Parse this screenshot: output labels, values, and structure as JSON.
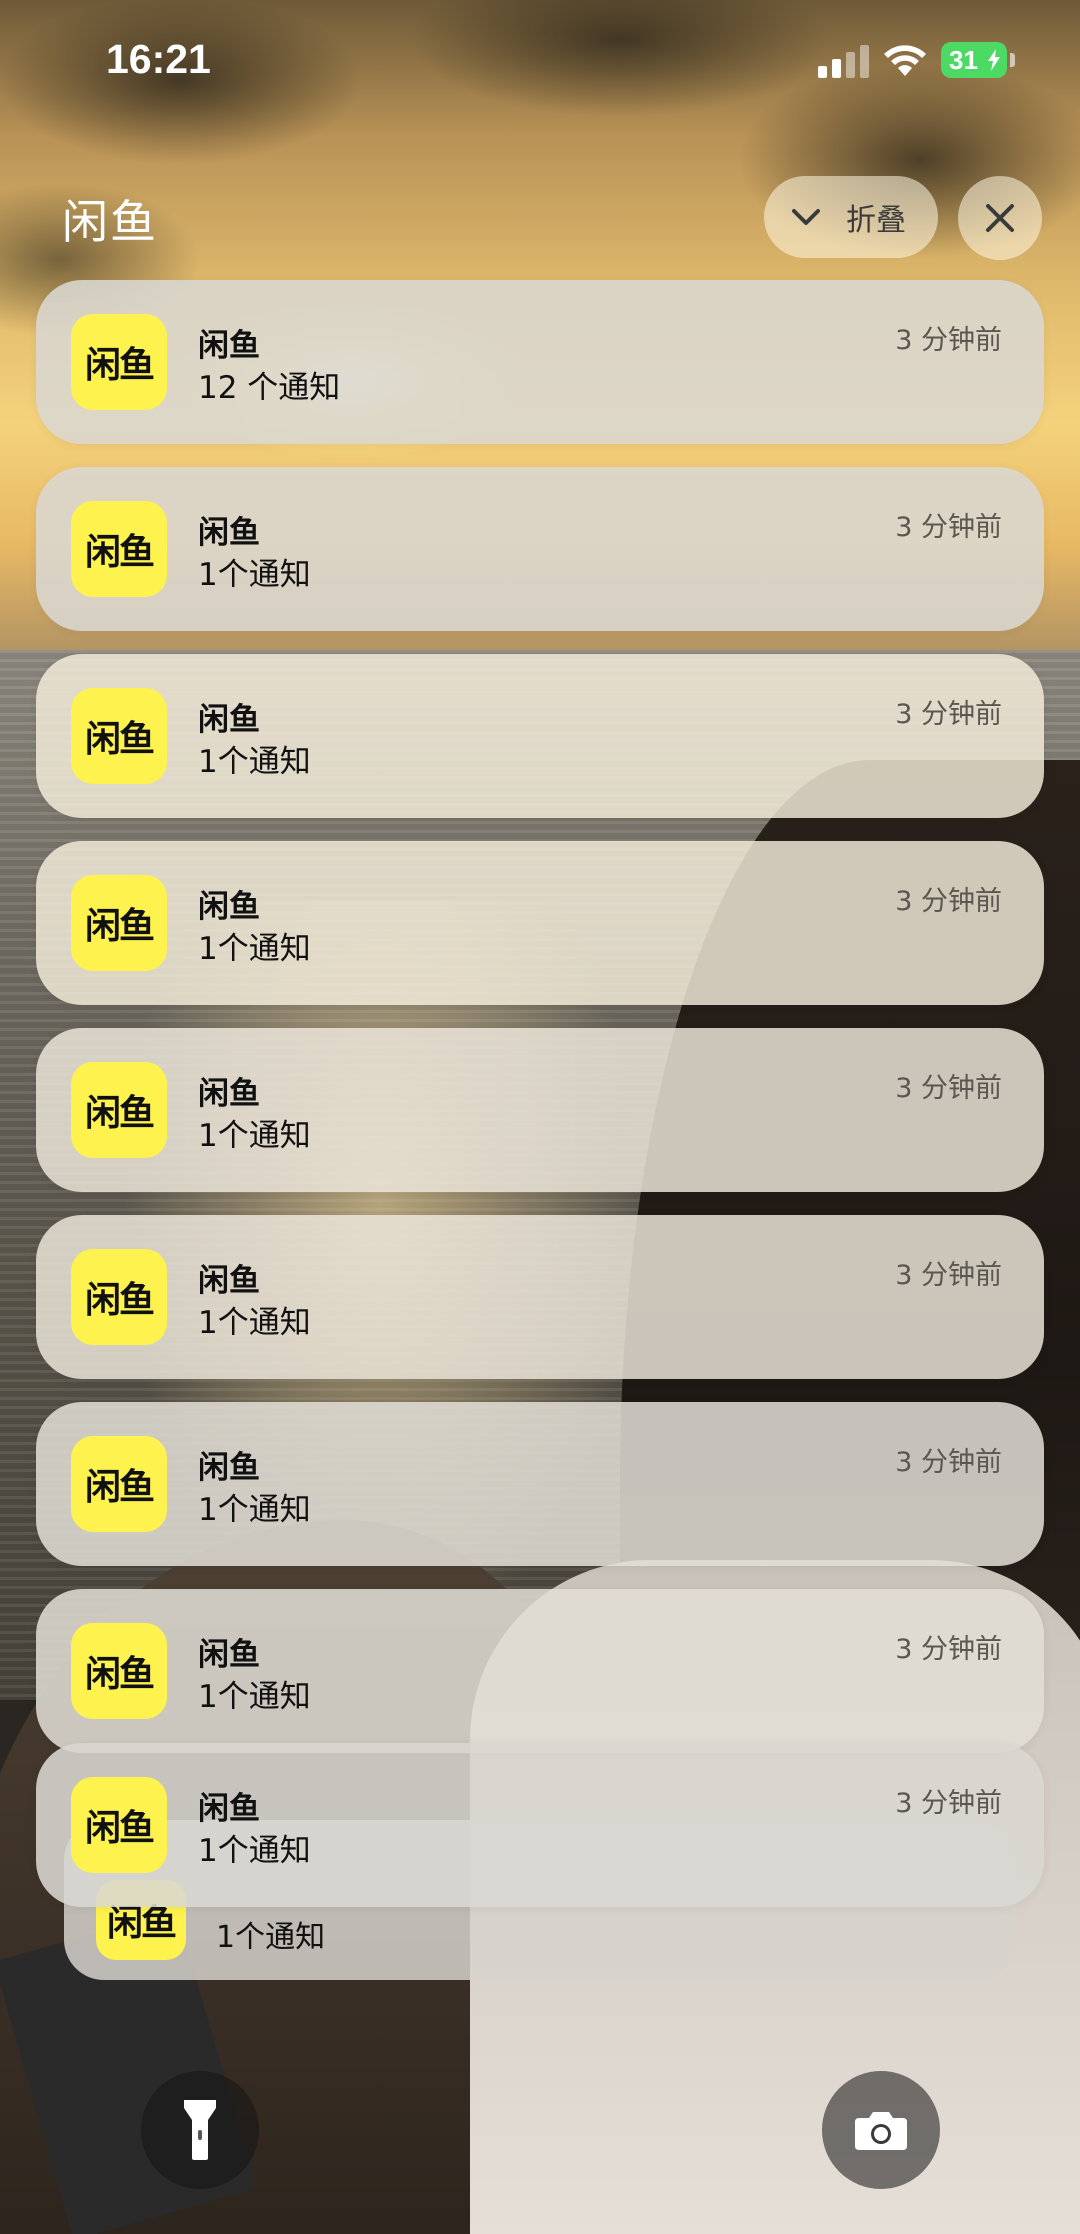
{
  "status_bar": {
    "time": "16:21",
    "battery": "31",
    "battery_color": "#4cd964"
  },
  "group": {
    "title": "闲鱼",
    "collapse_label": "折叠",
    "collapse_icon": "chevron-down-icon",
    "close_icon": "close-icon"
  },
  "app": {
    "icon_text": "闲鱼",
    "icon_color": "#fef24e"
  },
  "notifications": [
    {
      "app": "闲鱼",
      "body": "12 个通知",
      "time": "3 分钟前"
    },
    {
      "app": "闲鱼",
      "body": "1个通知",
      "time": "3 分钟前"
    },
    {
      "app": "闲鱼",
      "body": "1个通知",
      "time": "3 分钟前"
    },
    {
      "app": "闲鱼",
      "body": "1个通知",
      "time": "3 分钟前"
    },
    {
      "app": "闲鱼",
      "body": "1个通知",
      "time": "3 分钟前"
    },
    {
      "app": "闲鱼",
      "body": "1个通知",
      "time": "3 分钟前"
    },
    {
      "app": "闲鱼",
      "body": "1个通知",
      "time": "3 分钟前"
    },
    {
      "app": "闲鱼",
      "body": "1个通知",
      "time": "3 分钟前"
    },
    {
      "app": "闲鱼",
      "body": "1个通知",
      "time": "3 分钟前"
    }
  ],
  "stacked_tail": {
    "body": "1个通知"
  },
  "quick_actions": {
    "left_icon": "flashlight-icon",
    "right_icon": "camera-icon"
  }
}
